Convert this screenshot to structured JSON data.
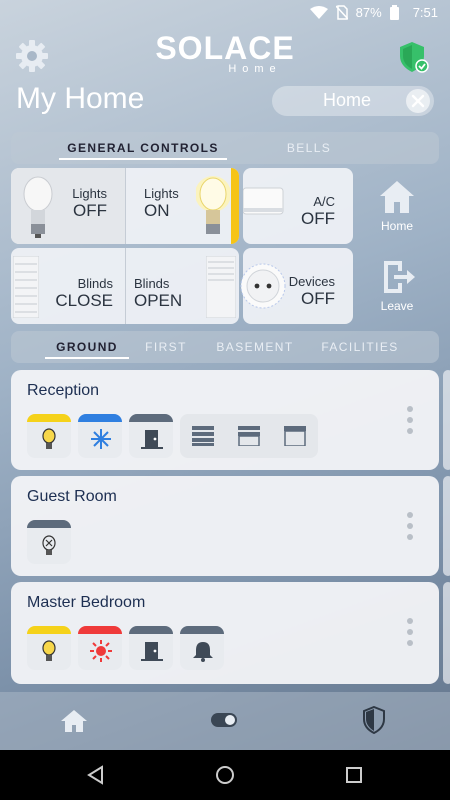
{
  "status_bar": {
    "battery": "87%",
    "time": "7:51"
  },
  "header": {
    "logo_main": "SOLACE",
    "logo_sub": "Home",
    "title": "My Home",
    "home_select": "Home"
  },
  "control_tabs": [
    {
      "label": "GENERAL CONTROLS",
      "active": true
    },
    {
      "label": "BELLS",
      "active": false
    }
  ],
  "controls": {
    "lights_off": {
      "label": "Lights",
      "state": "OFF"
    },
    "lights_on": {
      "label": "Lights",
      "state": "ON"
    },
    "ac": {
      "label": "A/C",
      "state": "OFF"
    },
    "blinds_close": {
      "label": "Blinds",
      "state": "CLOSE"
    },
    "blinds_open": {
      "label": "Blinds",
      "state": "OPEN"
    },
    "devices": {
      "label": "Devices",
      "state": "OFF"
    }
  },
  "side_buttons": {
    "home": "Home",
    "leave": "Leave"
  },
  "floor_tabs": [
    {
      "label": "GROUND",
      "active": true
    },
    {
      "label": "FIRST",
      "active": false
    },
    {
      "label": "BASEMENT",
      "active": false
    },
    {
      "label": "FACILITIES",
      "active": false
    }
  ],
  "rooms": [
    {
      "name": "Reception",
      "devices": [
        "light-bulb-icon",
        "snowflake-icon",
        "door-icon",
        "blinds-closed-icon",
        "blinds-half-icon",
        "blinds-open-icon"
      ]
    },
    {
      "name": "Guest Room",
      "devices": [
        "bulb-off-icon"
      ]
    },
    {
      "name": "Master Bedroom",
      "devices": [
        "light-bulb-icon",
        "sun-icon",
        "door-icon",
        "bell-icon"
      ]
    }
  ],
  "colors": {
    "cap_yellow": "#f5d21a",
    "cap_blue": "#2f7fe0",
    "cap_gray": "#5d6b7c",
    "cap_red": "#ef3a3a",
    "accent_yellow": "#f6c417",
    "shield_green": "#37c06a"
  }
}
